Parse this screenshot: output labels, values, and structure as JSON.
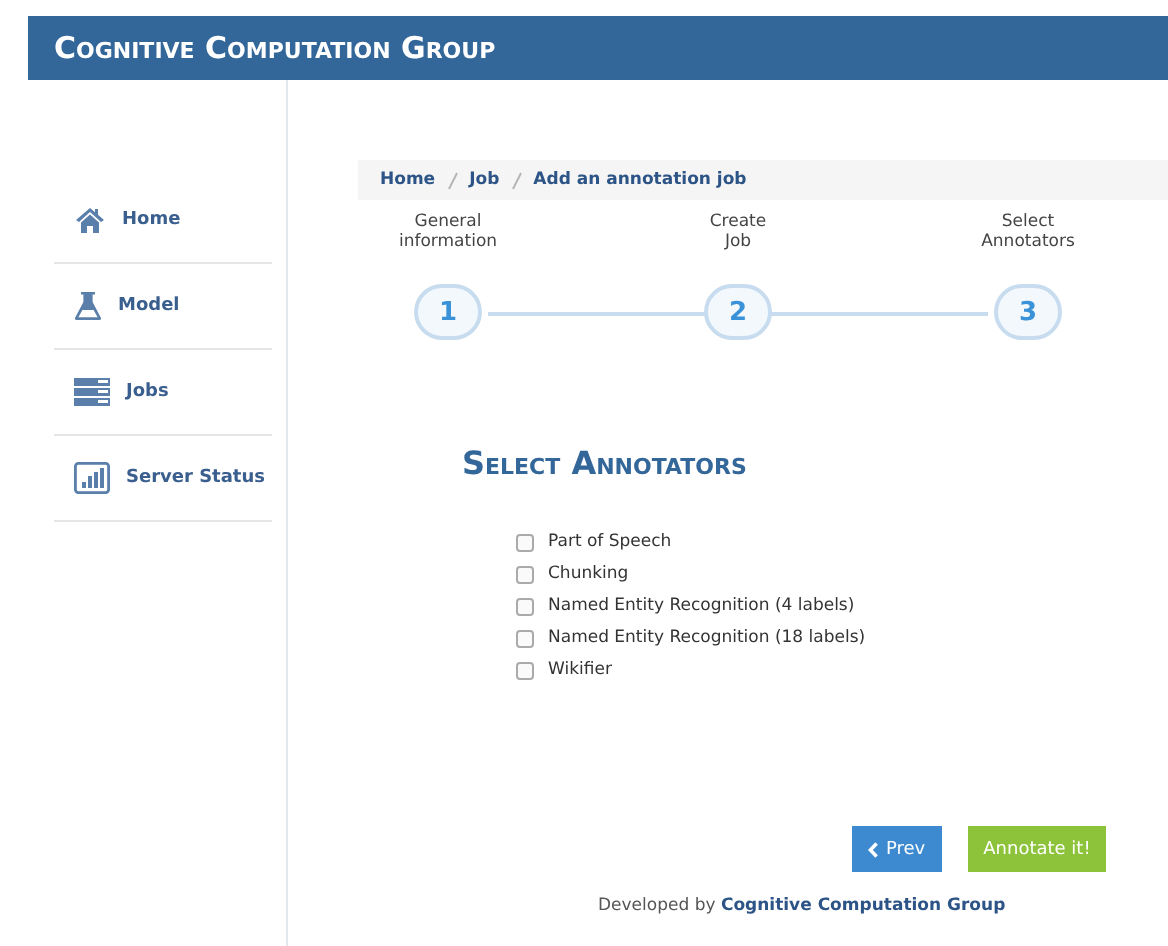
{
  "header": {
    "title": "Cognitive Computation Group"
  },
  "sidebar": {
    "items": [
      {
        "label": "Home"
      },
      {
        "label": "Model"
      },
      {
        "label": "Jobs"
      },
      {
        "label": "Server Status"
      }
    ]
  },
  "breadcrumb": [
    "Home",
    "Job",
    "Add an annotation job"
  ],
  "steps": [
    {
      "label": "General information",
      "number": "1"
    },
    {
      "label": "Create Job",
      "number": "2"
    },
    {
      "label": "Select Annotators",
      "number": "3"
    }
  ],
  "heading": "Select Annotators",
  "annotators": [
    {
      "label": "Part of Speech",
      "checked": false
    },
    {
      "label": "Chunking",
      "checked": false
    },
    {
      "label": "Named Entity Recognition (4 labels)",
      "checked": false
    },
    {
      "label": "Named Entity Recognition (18 labels)",
      "checked": false
    },
    {
      "label": "Wikifier",
      "checked": false
    }
  ],
  "buttons": {
    "prev": "Prev",
    "submit": "Annotate it!"
  },
  "footer": {
    "text": "Developed by",
    "link": "Cognitive Computation Group"
  }
}
